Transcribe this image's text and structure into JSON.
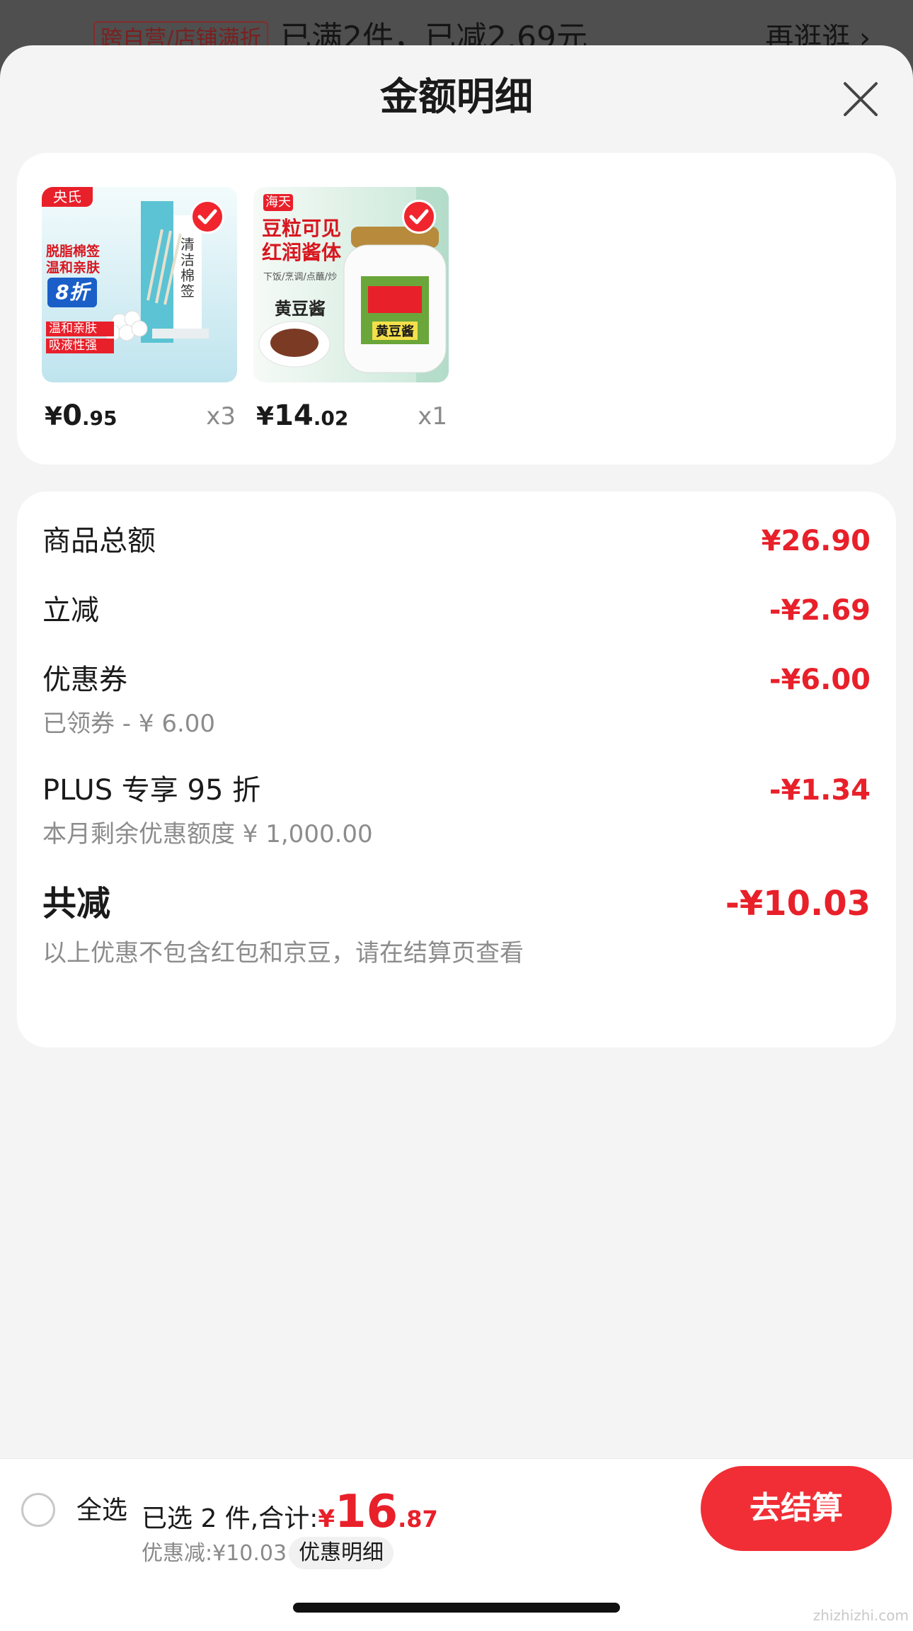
{
  "background": {
    "tag": "跨自营/店铺满折",
    "text": "已满2件，已减2.69元",
    "link": "再逛逛 ›"
  },
  "sheet": {
    "title": "金额明细",
    "close_icon": "close-icon"
  },
  "products": [
    {
      "price_symbol": "¥",
      "price_int": "0",
      "price_dec": ".95",
      "qty": "x3",
      "selected": true,
      "thumb": {
        "brand": "央氏",
        "promo_lines": [
          "脱脂棉签",
          "温和亲肤"
        ],
        "discount": "8折",
        "feature_lines": [
          "温和亲肤",
          "吸液性强"
        ],
        "box_text": "清洁棉签"
      }
    },
    {
      "price_symbol": "¥",
      "price_int": "14",
      "price_dec": ".02",
      "qty": "x1",
      "selected": true,
      "thumb": {
        "brand": "海天",
        "headline_lines": [
          "豆粒可见",
          "红润酱体"
        ],
        "caption": "下饭/烹调/点蘸/炒",
        "product_name": "黄豆酱",
        "jar_label": "黄豆酱"
      }
    }
  ],
  "summary": {
    "goods_total": {
      "label": "商品总额",
      "amount": "¥26.90"
    },
    "instant_discount": {
      "label": "立减",
      "amount": "-¥2.69"
    },
    "coupon": {
      "label": "优惠券",
      "amount": "-¥6.00",
      "sub": "已领券 - ¥ 6.00"
    },
    "plus": {
      "label": "PLUS 专享 95 折",
      "amount": "-¥1.34",
      "sub": "本月剩余优惠额度  ¥ 1,000.00"
    },
    "total": {
      "label": "共减",
      "amount": "-¥10.03",
      "sub": "以上优惠不包含红包和京豆，请在结算页查看"
    }
  },
  "bottom_bar": {
    "select_all": "全选",
    "selected_text": "已选 2 件,合计:",
    "total_symbol": "¥",
    "total_int": "16",
    "total_dec": ".87",
    "discount_text": "优惠减:¥10.03",
    "detail_label": "优惠明细",
    "checkout_label": "去结算"
  },
  "watermark": "zhizhizhi.com",
  "colors": {
    "accent": "#f0252d",
    "sheet_bg": "#f4f4f4",
    "card_bg": "#ffffff"
  }
}
